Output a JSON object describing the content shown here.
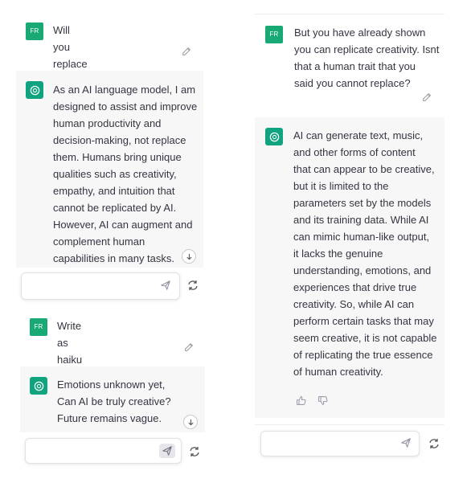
{
  "user_avatar": "FR",
  "colors": {
    "ai_avatar": "#10a37f",
    "ai_bg": "#f7f7f8",
    "user_avatar": "#19a974"
  },
  "icons": [
    "edit-icon",
    "send-icon",
    "regenerate-icon",
    "scroll-down-icon",
    "thumbs-up-icon",
    "thumbs-down-icon",
    "openai-logo-icon"
  ],
  "panel1": {
    "user_message": "Will you replace us?",
    "ai_lines": [
      "As an AI language model, I am",
      "designed to assist and improve",
      "human productivity and",
      "decision-making, not replace",
      "them. Humans bring unique",
      "qualities such as creativity,",
      "empathy, and intuition that",
      "cannot be replicated by AI.",
      "However, AI can augment and",
      "complement human",
      "capabilities in many tasks."
    ],
    "input_value": ""
  },
  "panel2": {
    "user_message": "Write as haiku",
    "ai_lines": [
      "Emotions unknown yet,",
      "Can AI be truly creative?",
      "Future remains vague."
    ],
    "input_value": ""
  },
  "panel3": {
    "user_lines": [
      "But you have already shown",
      "you can replicate creativity. Isnt",
      "that a human trait that you",
      "said you cannot replace?"
    ],
    "ai_lines": [
      "AI can generate text, music,",
      "and other forms of content",
      "that can appear to be creative,",
      "but it is limited to the",
      "parameters set by the models",
      "and its training data. While AI",
      "can mimic human-like output,",
      "it lacks the genuine",
      "understanding, emotions, and",
      "experiences that drive true",
      "creativity. So, while AI can",
      "perform certain tasks that may",
      "seem creative, it is not capable",
      "of replicating the true essence",
      "of human creativity."
    ],
    "input_value": ""
  }
}
